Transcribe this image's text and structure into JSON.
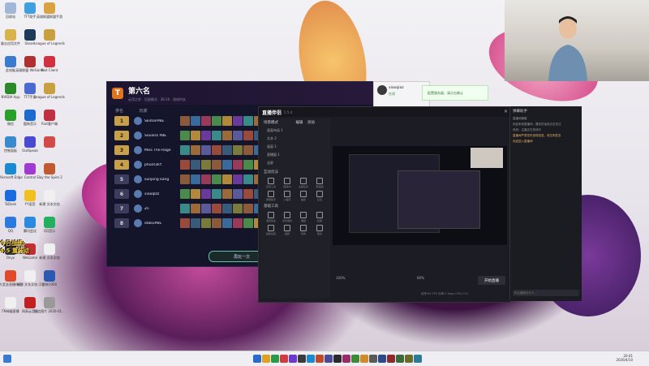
{
  "desktop_icons": [
    {
      "label": "回收站",
      "color": "#9fb8d8"
    },
    {
      "label": "TFT助手",
      "color": "#3fa0e0"
    },
    {
      "label": "英雄联盟联盟手游",
      "color": "#d9a340"
    },
    {
      "label": "备忘应用文件",
      "color": "#d8b24a"
    },
    {
      "label": "Steam",
      "color": "#1c3a5a"
    },
    {
      "label": "League of Legends",
      "color": "#c8a040"
    },
    {
      "label": "此电脑",
      "color": "#3a7ad0"
    },
    {
      "label": "英雄联盟 WeGame",
      "color": "#b03030"
    },
    {
      "label": "Riot Client",
      "color": "#d03040"
    },
    {
      "label": "NVIDIA App",
      "color": "#2a8a2a"
    },
    {
      "label": "TFT手游",
      "color": "#4a6ad0"
    },
    {
      "label": "League of Legends",
      "color": "#c8a040"
    },
    {
      "label": "微信",
      "color": "#2aa02a"
    },
    {
      "label": "酷狗音乐",
      "color": "#1a6ad0"
    },
    {
      "label": "Riot客户端",
      "color": "#c03040"
    },
    {
      "label": "控制面板",
      "color": "#3a8ad0"
    },
    {
      "label": "OutSpeak",
      "color": "#4a4ad0"
    },
    {
      "label": "",
      "color": "#d04a4a"
    },
    {
      "label": "Microsoft Edge",
      "color": "#1a8ad0"
    },
    {
      "label": "Control",
      "color": "#a03ad0"
    },
    {
      "label": "Slay the Spire 2",
      "color": "#c05a30"
    },
    {
      "label": "ToDesk",
      "color": "#1a6ae0"
    },
    {
      "label": "YY语音",
      "color": "#f0c020"
    },
    {
      "label": "新建 文本文档",
      "color": "#f0f0f0"
    },
    {
      "label": "QQ",
      "color": "#2a7ae0"
    },
    {
      "label": "腾讯会议",
      "color": "#2a8ae0"
    },
    {
      "label": "QQ音乐",
      "color": "#20b060"
    },
    {
      "label": "Onyx",
      "color": "#3a3a3a"
    },
    {
      "label": "WeGame",
      "color": "#c03030"
    },
    {
      "label": "新建 文本文档",
      "color": "#f0f0f0"
    },
    {
      "label": "大奖金直播伴侣",
      "color": "#e04a2a"
    },
    {
      "label": "新建 文本文档 (2)",
      "color": "#f0f0f0"
    },
    {
      "label": "雷神1000",
      "color": "#2a5ab0"
    },
    {
      "label": "FN神器直播",
      "color": "#f0f0f0"
    },
    {
      "label": "网易云音乐",
      "color": "#c02020"
    },
    {
      "label": "微信图片 2026-01...",
      "color": "#9a9a9a"
    }
  ],
  "overlay_text": {
    "line1": "今日战绩:",
    "line2": "4.5 重装动"
  },
  "game_window": {
    "title": "第六名",
    "subinfo": "云顶之弈 · 匹配模式 · 38:16 · 游戏时长",
    "col_rank": "排名",
    "col_player": "玩家",
    "rows": [
      {
        "rank": "1",
        "name": "SkimarPBE",
        "gold": true
      },
      {
        "rank": "2",
        "name": "Soulxss PBE",
        "gold": true
      },
      {
        "rank": "3",
        "name": "Miss The Rage",
        "gold": true
      },
      {
        "rank": "4",
        "name": "phunt3kY",
        "gold": true
      },
      {
        "rank": "5",
        "name": "sunjong kang",
        "gold": false
      },
      {
        "rank": "6",
        "name": "xiaoqlzz",
        "gold": false
      },
      {
        "rank": "7",
        "name": "Zli",
        "gold": false
      },
      {
        "rank": "8",
        "name": "otakuPBE",
        "gold": false
      }
    ],
    "play_again": "再玩一次"
  },
  "qq_window": {
    "name": "xiaoqiaz",
    "status": "在线"
  },
  "notice_bar": {
    "text": "配置服务器，请点击确认"
  },
  "studio": {
    "app_name": "直播伴侣",
    "version": "5.5.4",
    "tab_scene": "场景模式",
    "tab_edit": "编辑",
    "tab_add": "添加",
    "scene_items": [
      "画面布局 1",
      "文本 2",
      "画面 1",
      "直播窗 1",
      "全屏"
    ],
    "section_interact": "互动玩法",
    "section_tools": "基础工具",
    "tools": [
      "互动工具",
      "连线PK",
      "主播任务",
      "粉丝团",
      "弹幕助手",
      "小程序",
      "抽奖",
      "红包",
      "语音连麦",
      "定时发言",
      "福袋",
      "投票",
      "画质设置",
      "美颜",
      "音效",
      "更多"
    ],
    "go_live": "开始直播",
    "volume_a": "100%",
    "volume_b": "60%",
    "status": "帧率:60 FPS  码率:0 kbps  CPU:12%"
  },
  "chat_panel": {
    "title": "弹幕助手",
    "messages": [
      {
        "text": "直播间弹幕",
        "yellow": false
      },
      {
        "text": "欢迎来到直播间，喜欢的话请点击关注",
        "yellow": false
      },
      {
        "text": "系统：主播正在游戏中",
        "yellow": false
      },
      {
        "text": "直播间严禁发布违规信息，请文明发言",
        "yellow": true
      },
      {
        "text": "欢迎进入直播间",
        "yellow": true
      }
    ],
    "input_placeholder": "和主播聊点什么..."
  },
  "taskbar": {
    "time": "20:41",
    "date": "2026/4/10"
  }
}
